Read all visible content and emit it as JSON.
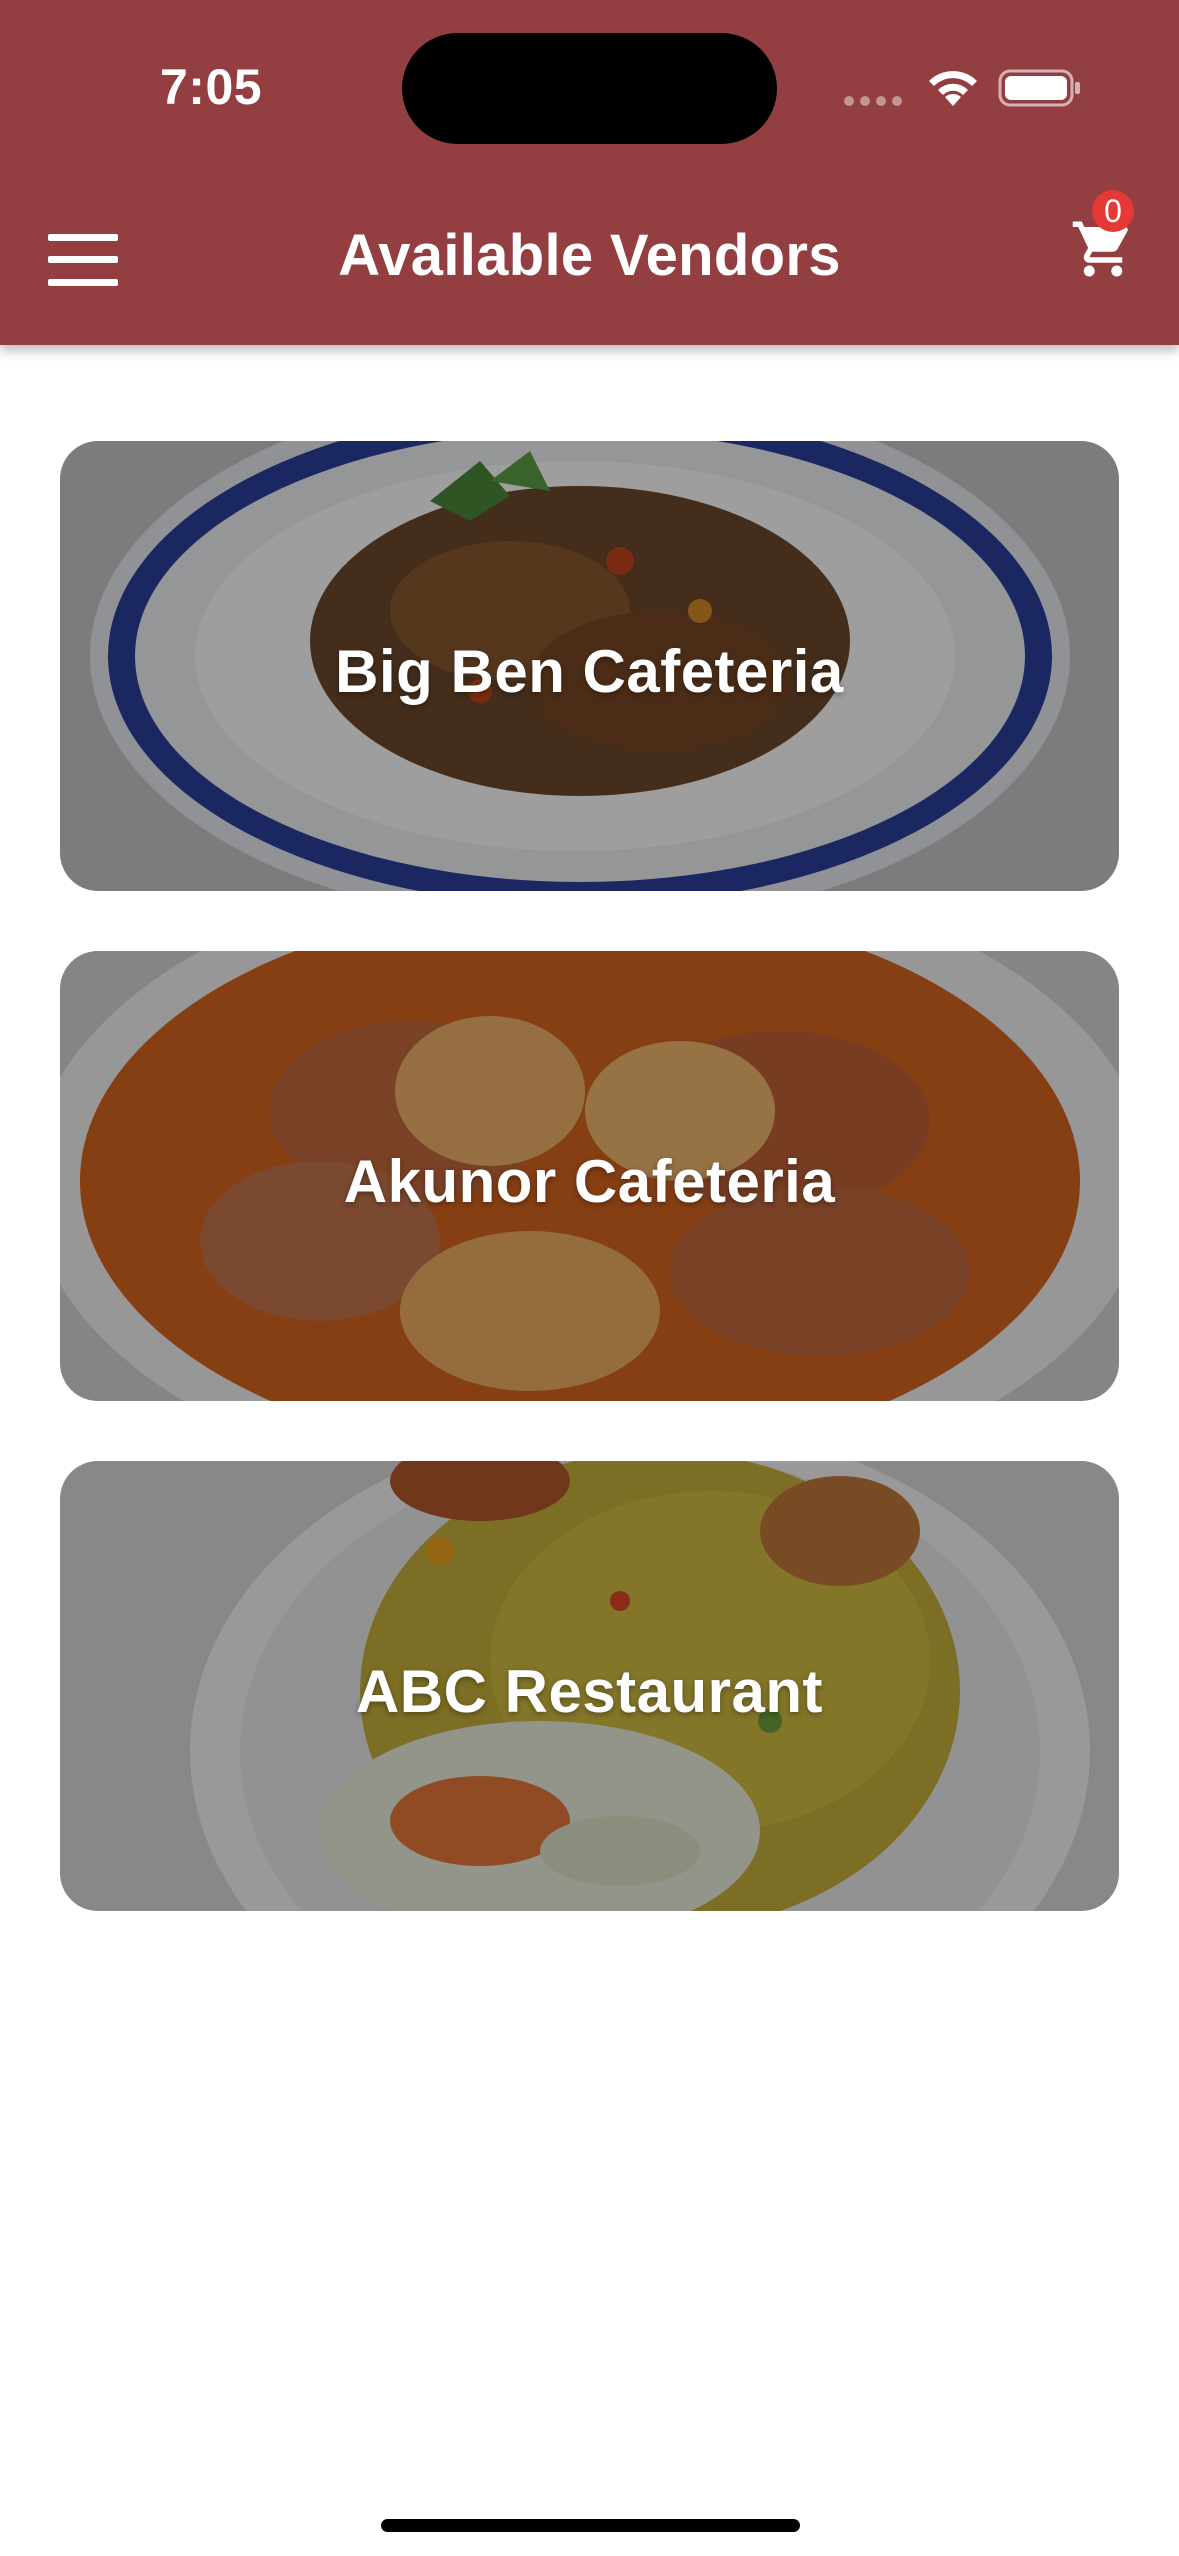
{
  "status_bar": {
    "time": "7:05"
  },
  "header": {
    "title": "Available Vendors",
    "menu_icon": "hamburger-menu-icon",
    "cart_icon": "shopping-cart-icon",
    "cart_count": "0",
    "background_color": "#933f42"
  },
  "vendors": [
    {
      "name": "Big Ben Cafeteria",
      "image": "rice-with-minced-meat-stew"
    },
    {
      "name": "Akunor Cafeteria",
      "image": "chicken-light-soup"
    },
    {
      "name": "ABC Restaurant",
      "image": "fried-rice-with-coleslaw-and-chicken"
    }
  ]
}
